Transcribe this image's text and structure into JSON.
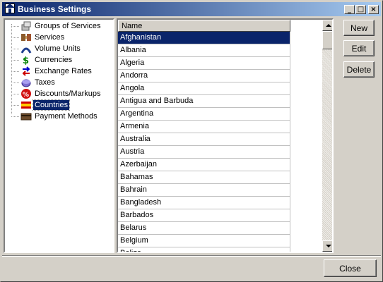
{
  "window": {
    "title": "Business Settings"
  },
  "titlebar_buttons": {
    "minimize": "_",
    "maximize": "□",
    "close": "×"
  },
  "tree": {
    "items": [
      {
        "label": "Groups of Services",
        "icon": "groups-icon"
      },
      {
        "label": "Services",
        "icon": "services-icon"
      },
      {
        "label": "Volume Units",
        "icon": "volume-units-icon"
      },
      {
        "label": "Currencies",
        "icon": "currency-dollar-icon"
      },
      {
        "label": "Exchange Rates",
        "icon": "exchange-arrows-icon"
      },
      {
        "label": "Taxes",
        "icon": "taxes-icon"
      },
      {
        "label": "Discounts/Markups",
        "icon": "percent-icon"
      },
      {
        "label": "Countries",
        "icon": "flag-icon",
        "selected": true
      },
      {
        "label": "Payment Methods",
        "icon": "payment-icon"
      }
    ]
  },
  "list": {
    "column_header": "Name",
    "rows": [
      "Afghanistan",
      "Albania",
      "Algeria",
      "Andorra",
      "Angola",
      "Antigua and Barbuda",
      "Argentina",
      "Armenia",
      "Australia",
      "Austria",
      "Azerbaijan",
      "Bahamas",
      "Bahrain",
      "Bangladesh",
      "Barbados",
      "Belarus",
      "Belgium",
      "Belize"
    ],
    "selected_index": 0
  },
  "buttons": {
    "new": "New",
    "edit": "Edit",
    "delete": "Delete",
    "close": "Close"
  },
  "colors": {
    "selection": "#0a246a",
    "face": "#d4d0c8"
  }
}
